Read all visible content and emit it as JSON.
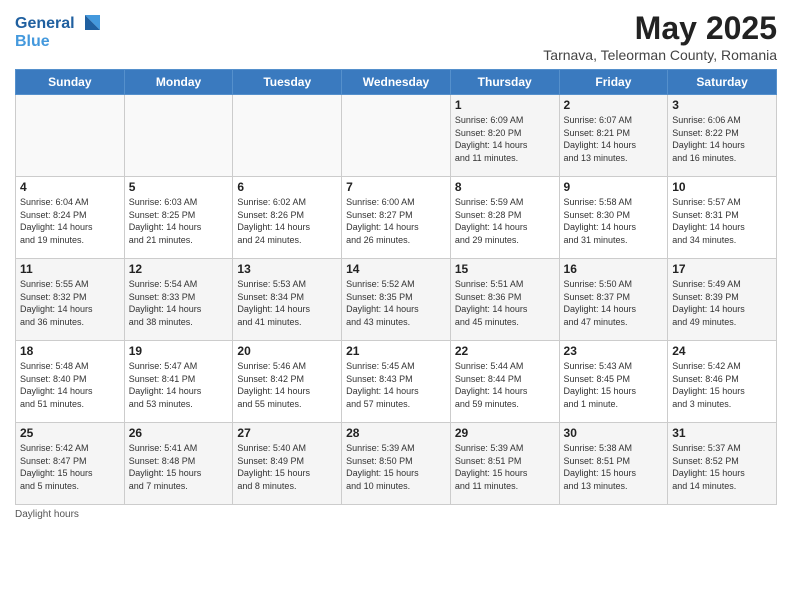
{
  "logo": {
    "line1": "General",
    "line2": "Blue"
  },
  "title": "May 2025",
  "subtitle": "Tarnava, Teleorman County, Romania",
  "days_of_week": [
    "Sunday",
    "Monday",
    "Tuesday",
    "Wednesday",
    "Thursday",
    "Friday",
    "Saturday"
  ],
  "weeks": [
    [
      {
        "day": "",
        "info": ""
      },
      {
        "day": "",
        "info": ""
      },
      {
        "day": "",
        "info": ""
      },
      {
        "day": "",
        "info": ""
      },
      {
        "day": "1",
        "info": "Sunrise: 6:09 AM\nSunset: 8:20 PM\nDaylight: 14 hours\nand 11 minutes."
      },
      {
        "day": "2",
        "info": "Sunrise: 6:07 AM\nSunset: 8:21 PM\nDaylight: 14 hours\nand 13 minutes."
      },
      {
        "day": "3",
        "info": "Sunrise: 6:06 AM\nSunset: 8:22 PM\nDaylight: 14 hours\nand 16 minutes."
      }
    ],
    [
      {
        "day": "4",
        "info": "Sunrise: 6:04 AM\nSunset: 8:24 PM\nDaylight: 14 hours\nand 19 minutes."
      },
      {
        "day": "5",
        "info": "Sunrise: 6:03 AM\nSunset: 8:25 PM\nDaylight: 14 hours\nand 21 minutes."
      },
      {
        "day": "6",
        "info": "Sunrise: 6:02 AM\nSunset: 8:26 PM\nDaylight: 14 hours\nand 24 minutes."
      },
      {
        "day": "7",
        "info": "Sunrise: 6:00 AM\nSunset: 8:27 PM\nDaylight: 14 hours\nand 26 minutes."
      },
      {
        "day": "8",
        "info": "Sunrise: 5:59 AM\nSunset: 8:28 PM\nDaylight: 14 hours\nand 29 minutes."
      },
      {
        "day": "9",
        "info": "Sunrise: 5:58 AM\nSunset: 8:30 PM\nDaylight: 14 hours\nand 31 minutes."
      },
      {
        "day": "10",
        "info": "Sunrise: 5:57 AM\nSunset: 8:31 PM\nDaylight: 14 hours\nand 34 minutes."
      }
    ],
    [
      {
        "day": "11",
        "info": "Sunrise: 5:55 AM\nSunset: 8:32 PM\nDaylight: 14 hours\nand 36 minutes."
      },
      {
        "day": "12",
        "info": "Sunrise: 5:54 AM\nSunset: 8:33 PM\nDaylight: 14 hours\nand 38 minutes."
      },
      {
        "day": "13",
        "info": "Sunrise: 5:53 AM\nSunset: 8:34 PM\nDaylight: 14 hours\nand 41 minutes."
      },
      {
        "day": "14",
        "info": "Sunrise: 5:52 AM\nSunset: 8:35 PM\nDaylight: 14 hours\nand 43 minutes."
      },
      {
        "day": "15",
        "info": "Sunrise: 5:51 AM\nSunset: 8:36 PM\nDaylight: 14 hours\nand 45 minutes."
      },
      {
        "day": "16",
        "info": "Sunrise: 5:50 AM\nSunset: 8:37 PM\nDaylight: 14 hours\nand 47 minutes."
      },
      {
        "day": "17",
        "info": "Sunrise: 5:49 AM\nSunset: 8:39 PM\nDaylight: 14 hours\nand 49 minutes."
      }
    ],
    [
      {
        "day": "18",
        "info": "Sunrise: 5:48 AM\nSunset: 8:40 PM\nDaylight: 14 hours\nand 51 minutes."
      },
      {
        "day": "19",
        "info": "Sunrise: 5:47 AM\nSunset: 8:41 PM\nDaylight: 14 hours\nand 53 minutes."
      },
      {
        "day": "20",
        "info": "Sunrise: 5:46 AM\nSunset: 8:42 PM\nDaylight: 14 hours\nand 55 minutes."
      },
      {
        "day": "21",
        "info": "Sunrise: 5:45 AM\nSunset: 8:43 PM\nDaylight: 14 hours\nand 57 minutes."
      },
      {
        "day": "22",
        "info": "Sunrise: 5:44 AM\nSunset: 8:44 PM\nDaylight: 14 hours\nand 59 minutes."
      },
      {
        "day": "23",
        "info": "Sunrise: 5:43 AM\nSunset: 8:45 PM\nDaylight: 15 hours\nand 1 minute."
      },
      {
        "day": "24",
        "info": "Sunrise: 5:42 AM\nSunset: 8:46 PM\nDaylight: 15 hours\nand 3 minutes."
      }
    ],
    [
      {
        "day": "25",
        "info": "Sunrise: 5:42 AM\nSunset: 8:47 PM\nDaylight: 15 hours\nand 5 minutes."
      },
      {
        "day": "26",
        "info": "Sunrise: 5:41 AM\nSunset: 8:48 PM\nDaylight: 15 hours\nand 7 minutes."
      },
      {
        "day": "27",
        "info": "Sunrise: 5:40 AM\nSunset: 8:49 PM\nDaylight: 15 hours\nand 8 minutes."
      },
      {
        "day": "28",
        "info": "Sunrise: 5:39 AM\nSunset: 8:50 PM\nDaylight: 15 hours\nand 10 minutes."
      },
      {
        "day": "29",
        "info": "Sunrise: 5:39 AM\nSunset: 8:51 PM\nDaylight: 15 hours\nand 11 minutes."
      },
      {
        "day": "30",
        "info": "Sunrise: 5:38 AM\nSunset: 8:51 PM\nDaylight: 15 hours\nand 13 minutes."
      },
      {
        "day": "31",
        "info": "Sunrise: 5:37 AM\nSunset: 8:52 PM\nDaylight: 15 hours\nand 14 minutes."
      }
    ]
  ],
  "footer": "Daylight hours"
}
